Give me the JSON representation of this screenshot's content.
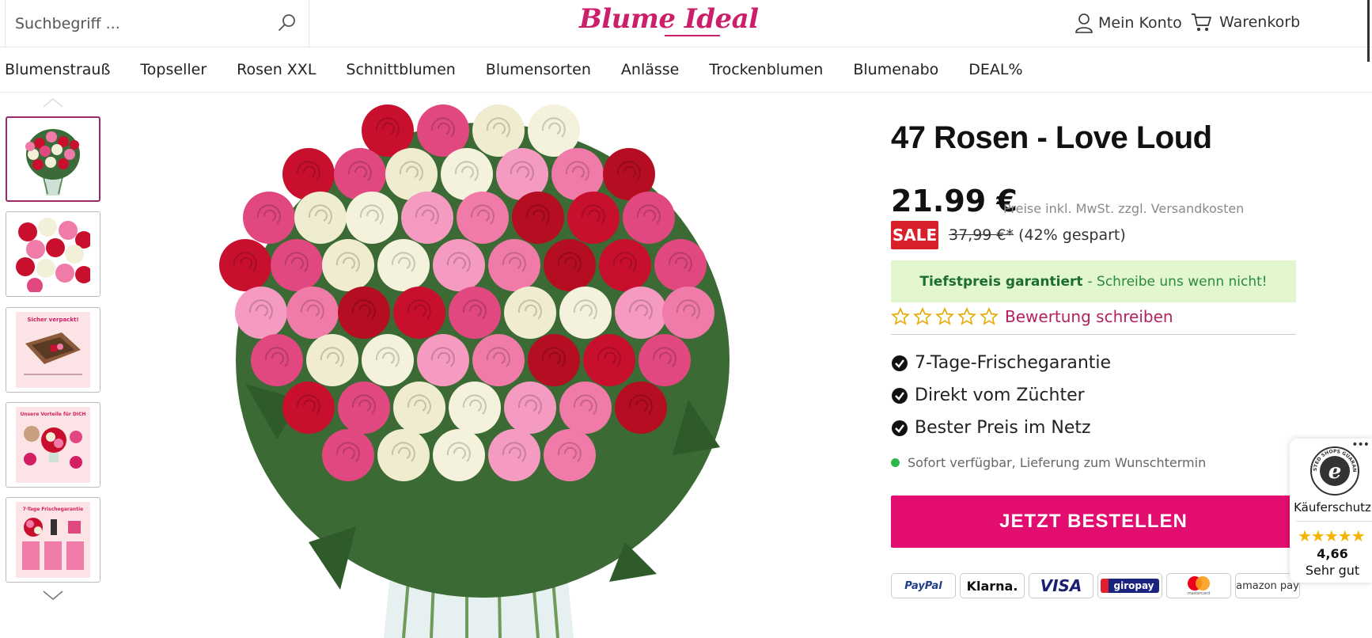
{
  "header": {
    "search_placeholder": "Suchbegriff ...",
    "logo_text": "Blume Ideal",
    "account_label": "Mein Konto",
    "cart_label": "Warenkorb",
    "brand_color": "#cc1f6b"
  },
  "nav": {
    "items": [
      "Blumenstrauß",
      "Topseller",
      "Rosen XXL",
      "Schnittblumen",
      "Blumensorten",
      "Anlässe",
      "Trockenblumen",
      "Blumenabo",
      "DEAL%"
    ]
  },
  "gallery": {
    "thumbnails": [
      {
        "name": "rose-bouquet-thumbnail",
        "text": ""
      },
      {
        "name": "rose-closeup-thumbnail",
        "text": ""
      },
      {
        "name": "packaging-info-thumbnail",
        "text": "Sicher verpackt!"
      },
      {
        "name": "advantages-thumbnail",
        "text": "Unsere Vorteile für DICH"
      },
      {
        "name": "freshness-guarantee-thumbnail",
        "text": "7-Tage Frischegarantie"
      }
    ],
    "selected_index": 0
  },
  "product": {
    "title": "47 Rosen - Love Loud",
    "price": "21.99 €",
    "price_note": "Preise inkl. MwSt. zzgl. Versandkosten",
    "sale_badge": "SALE",
    "old_price": "37,99 €*",
    "savings": "(42% gespart)",
    "lowprice_bold": "Tiefstpreis garantiert",
    "lowprice_rest": "- Schreibe uns wenn nicht!",
    "rating_stars": 0,
    "rating_max": 5,
    "review_link": "Bewertung schreiben",
    "usps": [
      "7-Tage-Frischegarantie",
      "Direkt vom Züchter",
      "Bester Preis im Netz"
    ],
    "availability": "Sofort verfügbar, Lieferung zum Wunschtermin",
    "order_button": "JETZT BESTELLEN",
    "accent_color": "#e20d6f",
    "sale_color": "#d9202a",
    "star_color": "#e6a800"
  },
  "payments": [
    "PayPal",
    "Klarna.",
    "VISA",
    "giropay",
    "mastercard",
    "amazon pay"
  ],
  "trusted_shops": {
    "seal_text": "TRUSTED SHOPS GUARANTEE",
    "label": "Käuferschutz",
    "stars": "★★★★★",
    "score": "4,66",
    "grade": "Sehr gut"
  }
}
